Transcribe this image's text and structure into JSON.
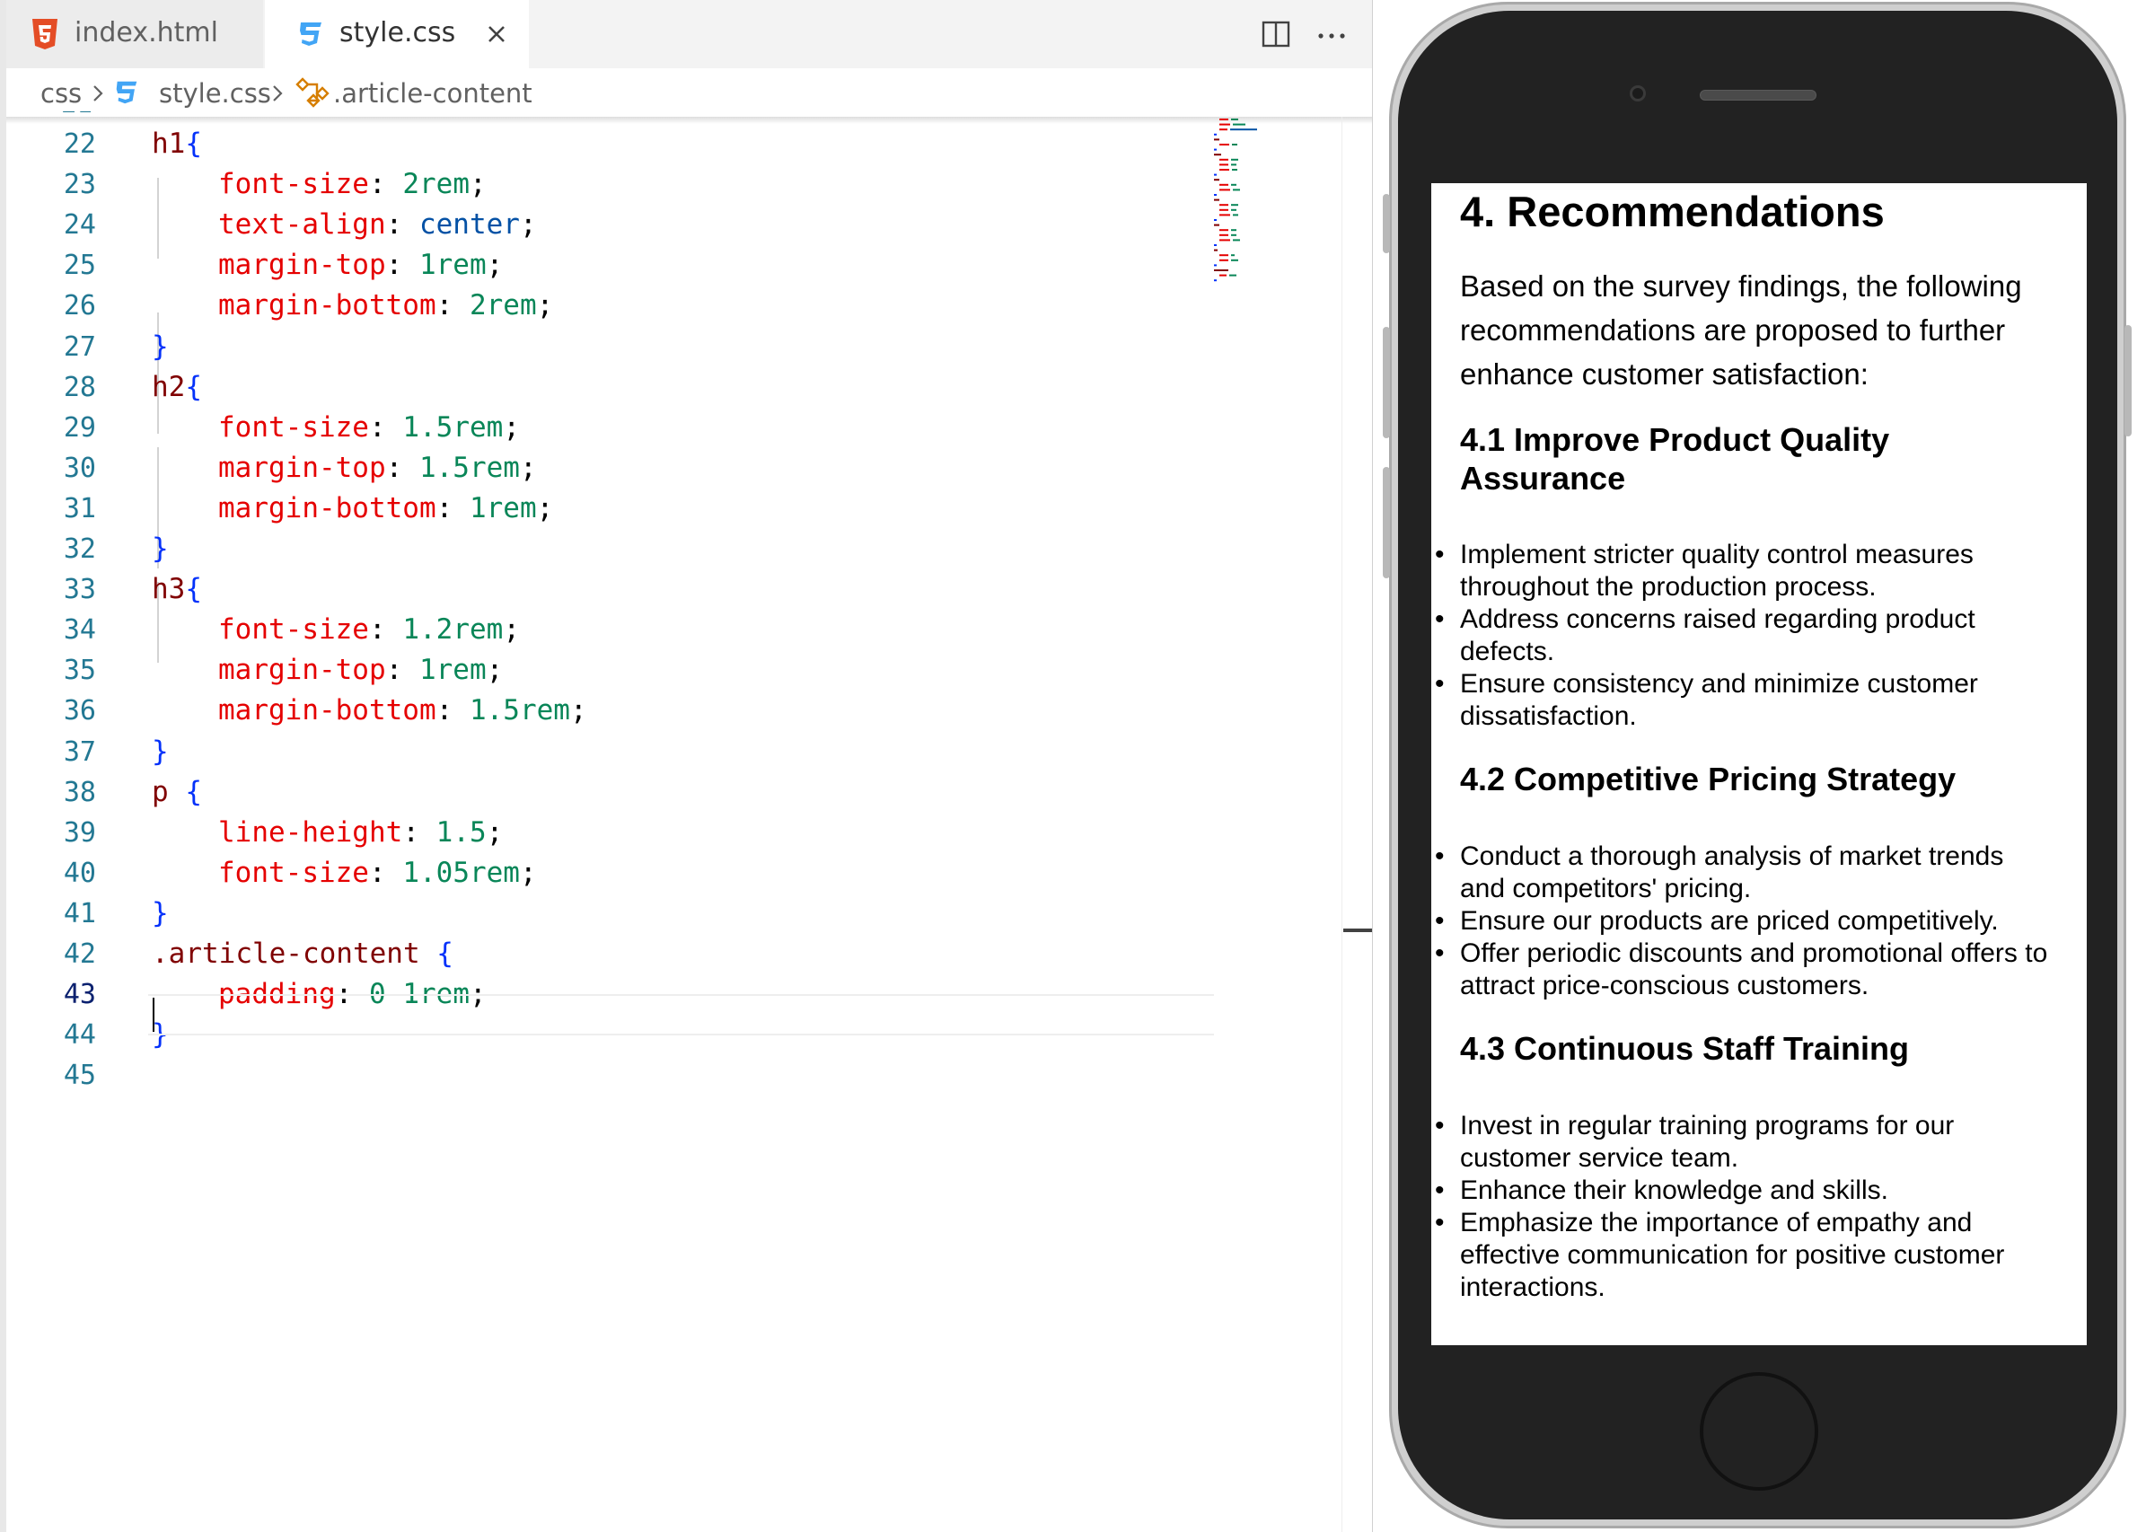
{
  "editor": {
    "tabs": [
      {
        "label": "index.html",
        "icon": "html5-icon",
        "active": false
      },
      {
        "label": "style.css",
        "icon": "css3-icon",
        "active": true
      }
    ],
    "breadcrumb": {
      "folder": "css",
      "file": "style.css",
      "symbol": ".article-content"
    },
    "current_line": 43,
    "lines": [
      {
        "n": "22",
        "text": "h1{"
      },
      {
        "n": "23",
        "text": "font-size: 2rem;"
      },
      {
        "n": "24",
        "text": "text-align: center;"
      },
      {
        "n": "25",
        "text": "margin-top: 1rem;"
      },
      {
        "n": "26",
        "text": "margin-bottom: 2rem;"
      },
      {
        "n": "27",
        "text": "}"
      },
      {
        "n": "28",
        "text": "h2{"
      },
      {
        "n": "29",
        "text": "font-size: 1.5rem;"
      },
      {
        "n": "30",
        "text": "margin-top: 1.5rem;"
      },
      {
        "n": "31",
        "text": "margin-bottom: 1rem;"
      },
      {
        "n": "32",
        "text": "}"
      },
      {
        "n": "33",
        "text": "h3{"
      },
      {
        "n": "34",
        "text": "font-size: 1.2rem;"
      },
      {
        "n": "35",
        "text": "margin-top: 1rem;"
      },
      {
        "n": "36",
        "text": "margin-bottom: 1.5rem;"
      },
      {
        "n": "37",
        "text": "}"
      },
      {
        "n": "38",
        "text": "p {"
      },
      {
        "n": "39",
        "text": "line-height: 1.5;"
      },
      {
        "n": "40",
        "text": "font-size: 1.05rem;"
      },
      {
        "n": "41",
        "text": "}"
      },
      {
        "n": "42",
        "text": ".article-content {"
      },
      {
        "n": "43",
        "text": "padding: 0 1rem;"
      },
      {
        "n": "44",
        "text": "}"
      },
      {
        "n": "45",
        "text": ""
      }
    ],
    "colors": {
      "selector": "#800000",
      "brace": "#0431fa",
      "property": "#e50000",
      "number": "#098658",
      "keyword": "#0451a5",
      "line_number": "#237893"
    }
  },
  "preview": {
    "heading": "4. Recommendations",
    "intro": "Based on the survey findings, the following recommendations are proposed to further enhance customer satisfaction:",
    "sections": [
      {
        "title": "4.1 Improve Product Quality Assurance",
        "items": [
          "Implement stricter quality control measures throughout the production process.",
          "Address concerns raised regarding product defects.",
          "Ensure consistency and minimize customer dissatisfaction."
        ]
      },
      {
        "title": "4.2 Competitive Pricing Strategy",
        "items": [
          "Conduct a thorough analysis of market trends and competitors' pricing.",
          "Ensure our products are priced competitively.",
          "Offer periodic discounts and promotional offers to attract price-conscious customers."
        ]
      },
      {
        "title": "4.3 Continuous Staff Training",
        "items": [
          "Invest in regular training programs for our customer service team.",
          "Enhance their knowledge and skills.",
          "Emphasize the importance of empathy and effective communication for positive customer interactions."
        ]
      }
    ]
  }
}
